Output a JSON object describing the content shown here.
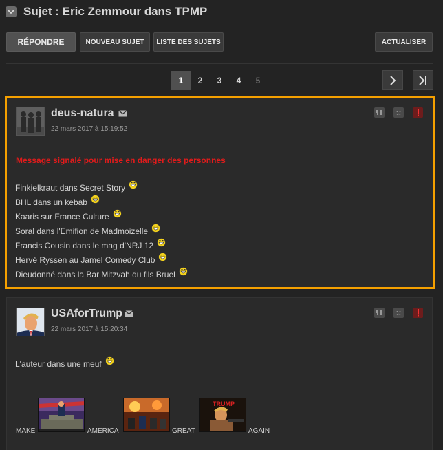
{
  "header": {
    "title": "Sujet : Eric Zemmour dans TPMP"
  },
  "toolbar": {
    "reply_label": "RÉPONDRE",
    "new_topic_label": "NOUVEAU SUJET",
    "topic_list_label": "LISTE DES SUJETS",
    "refresh_label": "ACTUALISER"
  },
  "pagination": {
    "pages": [
      "1",
      "2",
      "3",
      "4",
      "5"
    ],
    "current": "1"
  },
  "posts": [
    {
      "author": "deus-natura",
      "date": "22 mars 2017 à 15:19:52",
      "flag_message": "Message signalé pour mise en danger des personnes",
      "lines": [
        "Finkielkraut dans Secret Story",
        "BHL dans un kebab",
        "Kaaris sur France Culture",
        "Soral dans l'Emifion de Madmoizelle",
        "Francis Cousin dans le mag d'NRJ 12",
        "Hervé Ryssen au Jamel Comedy Club",
        "Dieudonné dans la Bar Mitzvah du fils Bruel"
      ]
    },
    {
      "author": "USAforTrump",
      "date": "22 mars 2017 à 15:20:34",
      "text": "L'auteur dans une meuf",
      "captions": [
        "MAKE",
        "AMERICA",
        "GREAT",
        "AGAIN"
      ],
      "image_text": "TRUMP"
    }
  ],
  "colors": {
    "highlight_border": "#f5a000",
    "flag_text": "#e01b1b",
    "background": "#232323"
  }
}
